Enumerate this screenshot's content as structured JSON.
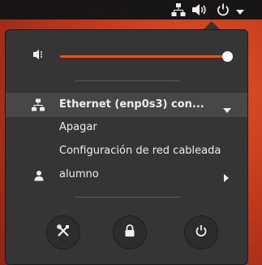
{
  "topbar": {
    "icons": [
      "network-wired-icon",
      "volume-icon",
      "power-icon",
      "chevron-down-icon"
    ]
  },
  "menu": {
    "volume": {
      "icon": "speaker-icon",
      "level": 1.0
    },
    "network": {
      "label": "Ethernet (enp0s3) con...",
      "actions": [
        "Apagar",
        "Configuración de red cableada"
      ]
    },
    "user": {
      "label": "alumno"
    },
    "buttons": [
      "settings-icon",
      "lock-icon",
      "power-icon"
    ]
  },
  "colors": {
    "accent": "#e95420",
    "popup_bg": "#353535",
    "highlight_bg": "#474747",
    "panel_bg": "#171515"
  }
}
